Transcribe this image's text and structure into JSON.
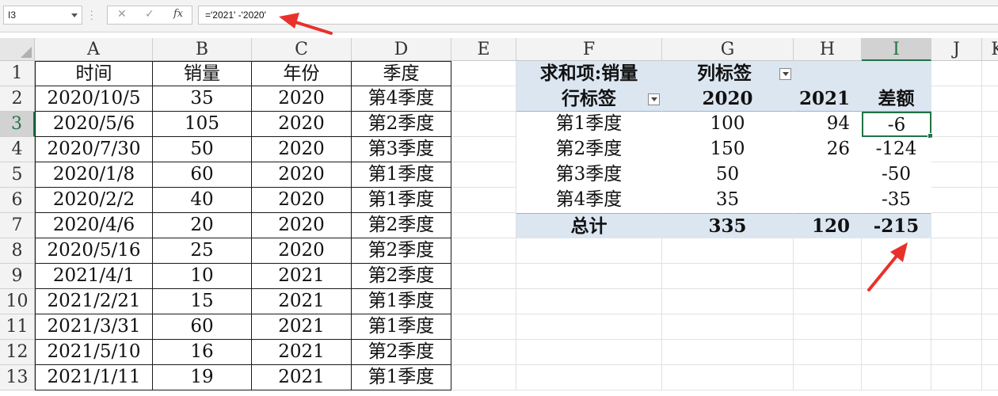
{
  "name_box": "I3",
  "formula_buttons": {
    "cancel": "✕",
    "confirm": "✓",
    "fx": "fx"
  },
  "formula": "='2021' -'2020'",
  "columns": [
    "A",
    "B",
    "C",
    "D",
    "E",
    "F",
    "G",
    "H",
    "I",
    "J",
    "K"
  ],
  "rows": [
    "1",
    "2",
    "3",
    "4",
    "5",
    "6",
    "7",
    "8",
    "9",
    "10",
    "11",
    "12",
    "13"
  ],
  "table": {
    "headers": [
      "时间",
      "销量",
      "年份",
      "季度"
    ],
    "rows": [
      [
        "2020/10/5",
        "35",
        "2020",
        "第4季度"
      ],
      [
        "2020/5/6",
        "105",
        "2020",
        "第2季度"
      ],
      [
        "2020/7/30",
        "50",
        "2020",
        "第3季度"
      ],
      [
        "2020/1/8",
        "60",
        "2020",
        "第1季度"
      ],
      [
        "2020/2/2",
        "40",
        "2020",
        "第1季度"
      ],
      [
        "2020/4/6",
        "20",
        "2020",
        "第2季度"
      ],
      [
        "2020/5/16",
        "25",
        "2020",
        "第2季度"
      ],
      [
        "2021/4/1",
        "10",
        "2021",
        "第2季度"
      ],
      [
        "2021/2/21",
        "15",
        "2021",
        "第1季度"
      ],
      [
        "2021/3/31",
        "60",
        "2021",
        "第1季度"
      ],
      [
        "2021/5/10",
        "16",
        "2021",
        "第2季度"
      ],
      [
        "2021/1/11",
        "19",
        "2021",
        "第1季度"
      ]
    ]
  },
  "pivot": {
    "value_label": "求和项:销量",
    "col_label": "列标签",
    "row_label": "行标签",
    "col_headers": [
      "2020",
      "2021",
      "差额"
    ],
    "rows": [
      {
        "label": "第1季度",
        "v2020": "100",
        "v2021": "94",
        "diff": "-6"
      },
      {
        "label": "第2季度",
        "v2020": "150",
        "v2021": "26",
        "diff": "-124"
      },
      {
        "label": "第3季度",
        "v2020": "50",
        "v2021": "",
        "diff": "-50"
      },
      {
        "label": "第4季度",
        "v2020": "35",
        "v2021": "",
        "diff": "-35"
      }
    ],
    "total": {
      "label": "总计",
      "v2020": "335",
      "v2021": "120",
      "diff": "-215"
    }
  },
  "colors": {
    "accent": "#217346",
    "pivot_fill": "#dce6f1",
    "arrow": "#e8312b"
  }
}
